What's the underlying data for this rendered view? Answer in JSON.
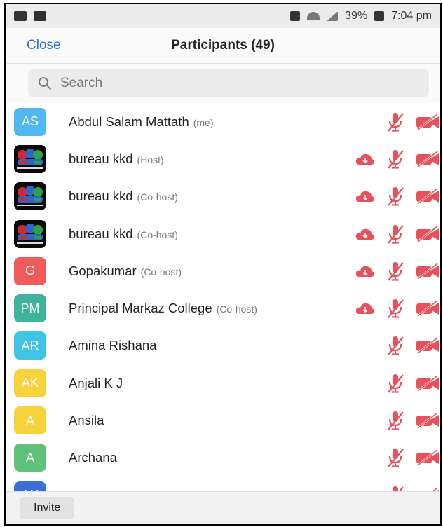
{
  "status_bar": {
    "battery": "39%",
    "time": "7:04 pm"
  },
  "header": {
    "close_label": "Close",
    "title": "Participants (49)"
  },
  "search": {
    "placeholder": "Search"
  },
  "participants": [
    {
      "initials": "AS",
      "color": "#4fb8f0",
      "name": "Abdul Salam Mattath",
      "role": "(me)",
      "cloud": false
    },
    {
      "initials": "",
      "color": "#0a0a0a",
      "logo": true,
      "name": "bureau kkd",
      "role": "(Host)",
      "cloud": true
    },
    {
      "initials": "",
      "color": "#0a0a0a",
      "logo": true,
      "name": "bureau kkd",
      "role": "(Co-host)",
      "cloud": true
    },
    {
      "initials": "",
      "color": "#0a0a0a",
      "logo": true,
      "name": "bureau kkd",
      "role": "(Co-host)",
      "cloud": true
    },
    {
      "initials": "G",
      "color": "#f05a5a",
      "name": "Gopakumar",
      "role": "(Co-host)",
      "cloud": true
    },
    {
      "initials": "PM",
      "color": "#3fb39b",
      "name": "Principal Markaz College",
      "role": "(Co-host)",
      "cloud": true
    },
    {
      "initials": "AR",
      "color": "#3fc4e6",
      "name": "Amina Rishana",
      "role": "",
      "cloud": false
    },
    {
      "initials": "AK",
      "color": "#f7d23a",
      "name": "Anjali K J",
      "role": "",
      "cloud": false
    },
    {
      "initials": "A",
      "color": "#f7d23a",
      "name": "Ansila",
      "role": "",
      "cloud": false
    },
    {
      "initials": "A",
      "color": "#5fc27a",
      "name": "Archana",
      "role": "",
      "cloud": false
    },
    {
      "initials": "AN",
      "color": "#3b6fd6",
      "name": "ASNA NASREEN",
      "role": "",
      "cloud": false
    }
  ],
  "footer": {
    "invite_label": "Invite"
  },
  "colors": {
    "accent": "#2d6ddc",
    "muted_red": "#e8505b"
  }
}
